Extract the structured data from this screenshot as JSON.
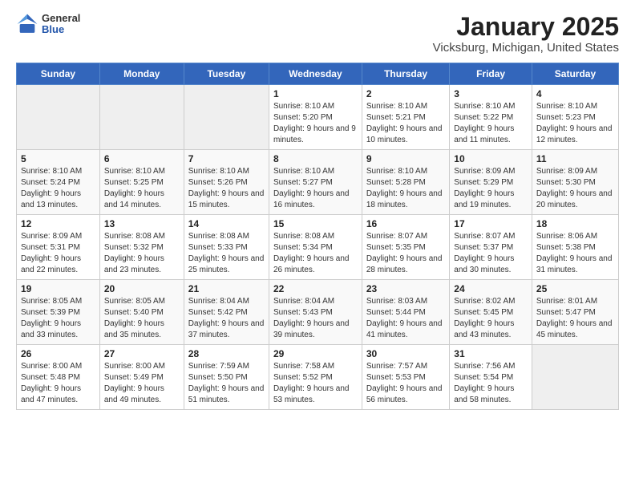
{
  "header": {
    "logo_general": "General",
    "logo_blue": "Blue",
    "month": "January 2025",
    "location": "Vicksburg, Michigan, United States"
  },
  "weekdays": [
    "Sunday",
    "Monday",
    "Tuesday",
    "Wednesday",
    "Thursday",
    "Friday",
    "Saturday"
  ],
  "weeks": [
    [
      {
        "day": "",
        "sunrise": "",
        "sunset": "",
        "daylight": ""
      },
      {
        "day": "",
        "sunrise": "",
        "sunset": "",
        "daylight": ""
      },
      {
        "day": "",
        "sunrise": "",
        "sunset": "",
        "daylight": ""
      },
      {
        "day": "1",
        "sunrise": "8:10 AM",
        "sunset": "5:20 PM",
        "daylight": "9 hours and 9 minutes."
      },
      {
        "day": "2",
        "sunrise": "8:10 AM",
        "sunset": "5:21 PM",
        "daylight": "9 hours and 10 minutes."
      },
      {
        "day": "3",
        "sunrise": "8:10 AM",
        "sunset": "5:22 PM",
        "daylight": "9 hours and 11 minutes."
      },
      {
        "day": "4",
        "sunrise": "8:10 AM",
        "sunset": "5:23 PM",
        "daylight": "9 hours and 12 minutes."
      }
    ],
    [
      {
        "day": "5",
        "sunrise": "8:10 AM",
        "sunset": "5:24 PM",
        "daylight": "9 hours and 13 minutes."
      },
      {
        "day": "6",
        "sunrise": "8:10 AM",
        "sunset": "5:25 PM",
        "daylight": "9 hours and 14 minutes."
      },
      {
        "day": "7",
        "sunrise": "8:10 AM",
        "sunset": "5:26 PM",
        "daylight": "9 hours and 15 minutes."
      },
      {
        "day": "8",
        "sunrise": "8:10 AM",
        "sunset": "5:27 PM",
        "daylight": "9 hours and 16 minutes."
      },
      {
        "day": "9",
        "sunrise": "8:10 AM",
        "sunset": "5:28 PM",
        "daylight": "9 hours and 18 minutes."
      },
      {
        "day": "10",
        "sunrise": "8:09 AM",
        "sunset": "5:29 PM",
        "daylight": "9 hours and 19 minutes."
      },
      {
        "day": "11",
        "sunrise": "8:09 AM",
        "sunset": "5:30 PM",
        "daylight": "9 hours and 20 minutes."
      }
    ],
    [
      {
        "day": "12",
        "sunrise": "8:09 AM",
        "sunset": "5:31 PM",
        "daylight": "9 hours and 22 minutes."
      },
      {
        "day": "13",
        "sunrise": "8:08 AM",
        "sunset": "5:32 PM",
        "daylight": "9 hours and 23 minutes."
      },
      {
        "day": "14",
        "sunrise": "8:08 AM",
        "sunset": "5:33 PM",
        "daylight": "9 hours and 25 minutes."
      },
      {
        "day": "15",
        "sunrise": "8:08 AM",
        "sunset": "5:34 PM",
        "daylight": "9 hours and 26 minutes."
      },
      {
        "day": "16",
        "sunrise": "8:07 AM",
        "sunset": "5:35 PM",
        "daylight": "9 hours and 28 minutes."
      },
      {
        "day": "17",
        "sunrise": "8:07 AM",
        "sunset": "5:37 PM",
        "daylight": "9 hours and 30 minutes."
      },
      {
        "day": "18",
        "sunrise": "8:06 AM",
        "sunset": "5:38 PM",
        "daylight": "9 hours and 31 minutes."
      }
    ],
    [
      {
        "day": "19",
        "sunrise": "8:05 AM",
        "sunset": "5:39 PM",
        "daylight": "9 hours and 33 minutes."
      },
      {
        "day": "20",
        "sunrise": "8:05 AM",
        "sunset": "5:40 PM",
        "daylight": "9 hours and 35 minutes."
      },
      {
        "day": "21",
        "sunrise": "8:04 AM",
        "sunset": "5:42 PM",
        "daylight": "9 hours and 37 minutes."
      },
      {
        "day": "22",
        "sunrise": "8:04 AM",
        "sunset": "5:43 PM",
        "daylight": "9 hours and 39 minutes."
      },
      {
        "day": "23",
        "sunrise": "8:03 AM",
        "sunset": "5:44 PM",
        "daylight": "9 hours and 41 minutes."
      },
      {
        "day": "24",
        "sunrise": "8:02 AM",
        "sunset": "5:45 PM",
        "daylight": "9 hours and 43 minutes."
      },
      {
        "day": "25",
        "sunrise": "8:01 AM",
        "sunset": "5:47 PM",
        "daylight": "9 hours and 45 minutes."
      }
    ],
    [
      {
        "day": "26",
        "sunrise": "8:00 AM",
        "sunset": "5:48 PM",
        "daylight": "9 hours and 47 minutes."
      },
      {
        "day": "27",
        "sunrise": "8:00 AM",
        "sunset": "5:49 PM",
        "daylight": "9 hours and 49 minutes."
      },
      {
        "day": "28",
        "sunrise": "7:59 AM",
        "sunset": "5:50 PM",
        "daylight": "9 hours and 51 minutes."
      },
      {
        "day": "29",
        "sunrise": "7:58 AM",
        "sunset": "5:52 PM",
        "daylight": "9 hours and 53 minutes."
      },
      {
        "day": "30",
        "sunrise": "7:57 AM",
        "sunset": "5:53 PM",
        "daylight": "9 hours and 56 minutes."
      },
      {
        "day": "31",
        "sunrise": "7:56 AM",
        "sunset": "5:54 PM",
        "daylight": "9 hours and 58 minutes."
      },
      {
        "day": "",
        "sunrise": "",
        "sunset": "",
        "daylight": ""
      }
    ]
  ]
}
